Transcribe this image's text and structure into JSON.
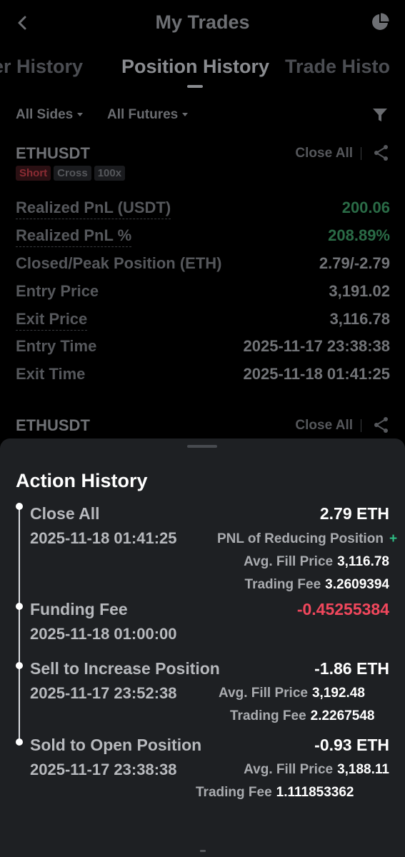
{
  "header": {
    "title": "My Trades",
    "back_icon": "chevron-left-icon",
    "stats_icon": "pie-chart-icon"
  },
  "tabs": [
    {
      "label": "Order History",
      "visible_text": "er History",
      "active": false
    },
    {
      "label": "Position History",
      "visible_text": "Position History",
      "active": true
    },
    {
      "label": "Trade History",
      "visible_text": "Trade Histo",
      "active": false
    }
  ],
  "filters": {
    "sides": "All Sides",
    "futures": "All Futures",
    "filter_icon": "funnel-icon"
  },
  "positions": [
    {
      "symbol": "ETHUSDT",
      "close_all": "Close All",
      "tags": [
        "Short",
        "Cross",
        "100x"
      ],
      "rows": [
        {
          "label": "Realized PnL (USDT)",
          "value": "200.06",
          "tone": "green",
          "dotted": true
        },
        {
          "label": "Realized PnL %",
          "value": "208.89%",
          "tone": "green",
          "dotted": true
        },
        {
          "label": "Closed/Peak Position (ETH)",
          "value": "2.79/-2.79",
          "tone": "neutral",
          "dotted": false
        },
        {
          "label": "Entry Price",
          "value": "3,191.02",
          "tone": "neutral",
          "dotted": false
        },
        {
          "label": "Exit Price",
          "value": "3,116.78",
          "tone": "neutral",
          "dotted": true
        },
        {
          "label": "Entry Time",
          "value": "2025-11-17 23:38:38",
          "tone": "neutral",
          "dotted": false
        },
        {
          "label": "Exit Time",
          "value": "2025-11-18 01:41:25",
          "tone": "neutral",
          "dotted": false
        }
      ]
    },
    {
      "symbol": "ETHUSDT",
      "close_all": "Close All"
    }
  ],
  "sheet": {
    "title": "Action History",
    "entries": [
      {
        "name": "Close All",
        "time": "2025-11-18 01:41:25",
        "amount": "2.79 ETH",
        "amount_tone": "white",
        "details": [
          {
            "label": "PNL of Reducing Position",
            "value": "+"
          },
          {
            "label": "Avg. Fill Price",
            "value": "3,116.78"
          },
          {
            "label": "Trading Fee",
            "value": "3.2609394"
          }
        ]
      },
      {
        "name": "Funding Fee",
        "time": "2025-11-18 01:00:00",
        "amount": "-0.45255384",
        "amount_tone": "red",
        "details": []
      },
      {
        "name": "Sell to Increase Position",
        "time": "2025-11-17 23:52:38",
        "amount": "-1.86 ETH",
        "amount_tone": "white",
        "details": [
          {
            "label": "Avg. Fill Price",
            "value": "3,192.48"
          },
          {
            "label": "Trading Fee",
            "value": "2.2267548"
          }
        ]
      },
      {
        "name": "Sold to Open Position",
        "time": "2025-11-17 23:38:38",
        "amount": "-0.93 ETH",
        "amount_tone": "white",
        "details": [
          {
            "label": "Avg. Fill Price",
            "value": "3,188.11"
          },
          {
            "label": "Trading Fee",
            "value": "1.111853362"
          }
        ]
      }
    ]
  },
  "colors": {
    "positive": "#2ebd85",
    "negative": "#f0475c",
    "sheet_bg": "#1e2023"
  }
}
